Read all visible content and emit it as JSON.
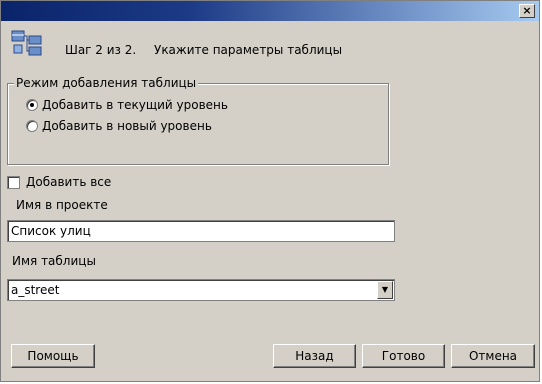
{
  "window": {
    "close_label": "×"
  },
  "header": {
    "step": "Шаг 2 из 2.",
    "title": "Укажите параметры таблицы"
  },
  "mode_group": {
    "legend": "Режим добавления таблицы",
    "options": [
      {
        "label": "Добавить в текущий уровень",
        "checked": true
      },
      {
        "label": "Добавить в новый уровень",
        "checked": false
      }
    ]
  },
  "add_all": {
    "label": "Добавить все",
    "checked": false
  },
  "project_name": {
    "label": "Имя в проекте",
    "value": "Список улиц"
  },
  "table_name": {
    "label": "Имя таблицы",
    "value": "a_street"
  },
  "buttons": {
    "help": "Помощь",
    "back": "Назад",
    "done": "Готово",
    "cancel": "Отмена"
  },
  "colors": {
    "dialog_bg": "#d4d0c8",
    "titlebar_start": "#0a246a",
    "titlebar_end": "#a6caf0"
  },
  "icons": {
    "header": "table-tree-icon",
    "close": "close-icon",
    "dropdown": "chevron-down-icon"
  }
}
